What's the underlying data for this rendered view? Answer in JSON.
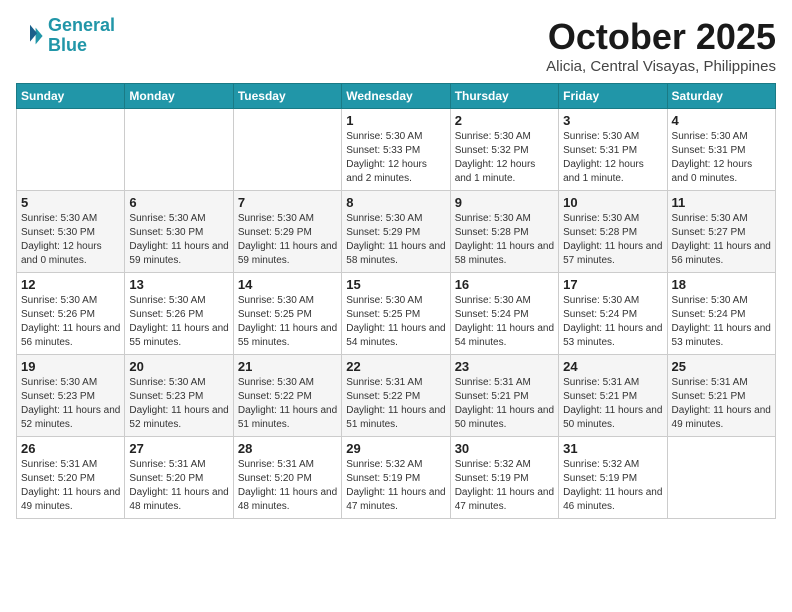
{
  "header": {
    "logo_line1": "General",
    "logo_line2": "Blue",
    "month": "October 2025",
    "location": "Alicia, Central Visayas, Philippines"
  },
  "weekdays": [
    "Sunday",
    "Monday",
    "Tuesday",
    "Wednesday",
    "Thursday",
    "Friday",
    "Saturday"
  ],
  "weeks": [
    [
      {
        "day": "",
        "info": ""
      },
      {
        "day": "",
        "info": ""
      },
      {
        "day": "",
        "info": ""
      },
      {
        "day": "1",
        "info": "Sunrise: 5:30 AM\nSunset: 5:33 PM\nDaylight: 12 hours and 2 minutes."
      },
      {
        "day": "2",
        "info": "Sunrise: 5:30 AM\nSunset: 5:32 PM\nDaylight: 12 hours and 1 minute."
      },
      {
        "day": "3",
        "info": "Sunrise: 5:30 AM\nSunset: 5:31 PM\nDaylight: 12 hours and 1 minute."
      },
      {
        "day": "4",
        "info": "Sunrise: 5:30 AM\nSunset: 5:31 PM\nDaylight: 12 hours and 0 minutes."
      }
    ],
    [
      {
        "day": "5",
        "info": "Sunrise: 5:30 AM\nSunset: 5:30 PM\nDaylight: 12 hours and 0 minutes."
      },
      {
        "day": "6",
        "info": "Sunrise: 5:30 AM\nSunset: 5:30 PM\nDaylight: 11 hours and 59 minutes."
      },
      {
        "day": "7",
        "info": "Sunrise: 5:30 AM\nSunset: 5:29 PM\nDaylight: 11 hours and 59 minutes."
      },
      {
        "day": "8",
        "info": "Sunrise: 5:30 AM\nSunset: 5:29 PM\nDaylight: 11 hours and 58 minutes."
      },
      {
        "day": "9",
        "info": "Sunrise: 5:30 AM\nSunset: 5:28 PM\nDaylight: 11 hours and 58 minutes."
      },
      {
        "day": "10",
        "info": "Sunrise: 5:30 AM\nSunset: 5:28 PM\nDaylight: 11 hours and 57 minutes."
      },
      {
        "day": "11",
        "info": "Sunrise: 5:30 AM\nSunset: 5:27 PM\nDaylight: 11 hours and 56 minutes."
      }
    ],
    [
      {
        "day": "12",
        "info": "Sunrise: 5:30 AM\nSunset: 5:26 PM\nDaylight: 11 hours and 56 minutes."
      },
      {
        "day": "13",
        "info": "Sunrise: 5:30 AM\nSunset: 5:26 PM\nDaylight: 11 hours and 55 minutes."
      },
      {
        "day": "14",
        "info": "Sunrise: 5:30 AM\nSunset: 5:25 PM\nDaylight: 11 hours and 55 minutes."
      },
      {
        "day": "15",
        "info": "Sunrise: 5:30 AM\nSunset: 5:25 PM\nDaylight: 11 hours and 54 minutes."
      },
      {
        "day": "16",
        "info": "Sunrise: 5:30 AM\nSunset: 5:24 PM\nDaylight: 11 hours and 54 minutes."
      },
      {
        "day": "17",
        "info": "Sunrise: 5:30 AM\nSunset: 5:24 PM\nDaylight: 11 hours and 53 minutes."
      },
      {
        "day": "18",
        "info": "Sunrise: 5:30 AM\nSunset: 5:24 PM\nDaylight: 11 hours and 53 minutes."
      }
    ],
    [
      {
        "day": "19",
        "info": "Sunrise: 5:30 AM\nSunset: 5:23 PM\nDaylight: 11 hours and 52 minutes."
      },
      {
        "day": "20",
        "info": "Sunrise: 5:30 AM\nSunset: 5:23 PM\nDaylight: 11 hours and 52 minutes."
      },
      {
        "day": "21",
        "info": "Sunrise: 5:30 AM\nSunset: 5:22 PM\nDaylight: 11 hours and 51 minutes."
      },
      {
        "day": "22",
        "info": "Sunrise: 5:31 AM\nSunset: 5:22 PM\nDaylight: 11 hours and 51 minutes."
      },
      {
        "day": "23",
        "info": "Sunrise: 5:31 AM\nSunset: 5:21 PM\nDaylight: 11 hours and 50 minutes."
      },
      {
        "day": "24",
        "info": "Sunrise: 5:31 AM\nSunset: 5:21 PM\nDaylight: 11 hours and 50 minutes."
      },
      {
        "day": "25",
        "info": "Sunrise: 5:31 AM\nSunset: 5:21 PM\nDaylight: 11 hours and 49 minutes."
      }
    ],
    [
      {
        "day": "26",
        "info": "Sunrise: 5:31 AM\nSunset: 5:20 PM\nDaylight: 11 hours and 49 minutes."
      },
      {
        "day": "27",
        "info": "Sunrise: 5:31 AM\nSunset: 5:20 PM\nDaylight: 11 hours and 48 minutes."
      },
      {
        "day": "28",
        "info": "Sunrise: 5:31 AM\nSunset: 5:20 PM\nDaylight: 11 hours and 48 minutes."
      },
      {
        "day": "29",
        "info": "Sunrise: 5:32 AM\nSunset: 5:19 PM\nDaylight: 11 hours and 47 minutes."
      },
      {
        "day": "30",
        "info": "Sunrise: 5:32 AM\nSunset: 5:19 PM\nDaylight: 11 hours and 47 minutes."
      },
      {
        "day": "31",
        "info": "Sunrise: 5:32 AM\nSunset: 5:19 PM\nDaylight: 11 hours and 46 minutes."
      },
      {
        "day": "",
        "info": ""
      }
    ]
  ]
}
